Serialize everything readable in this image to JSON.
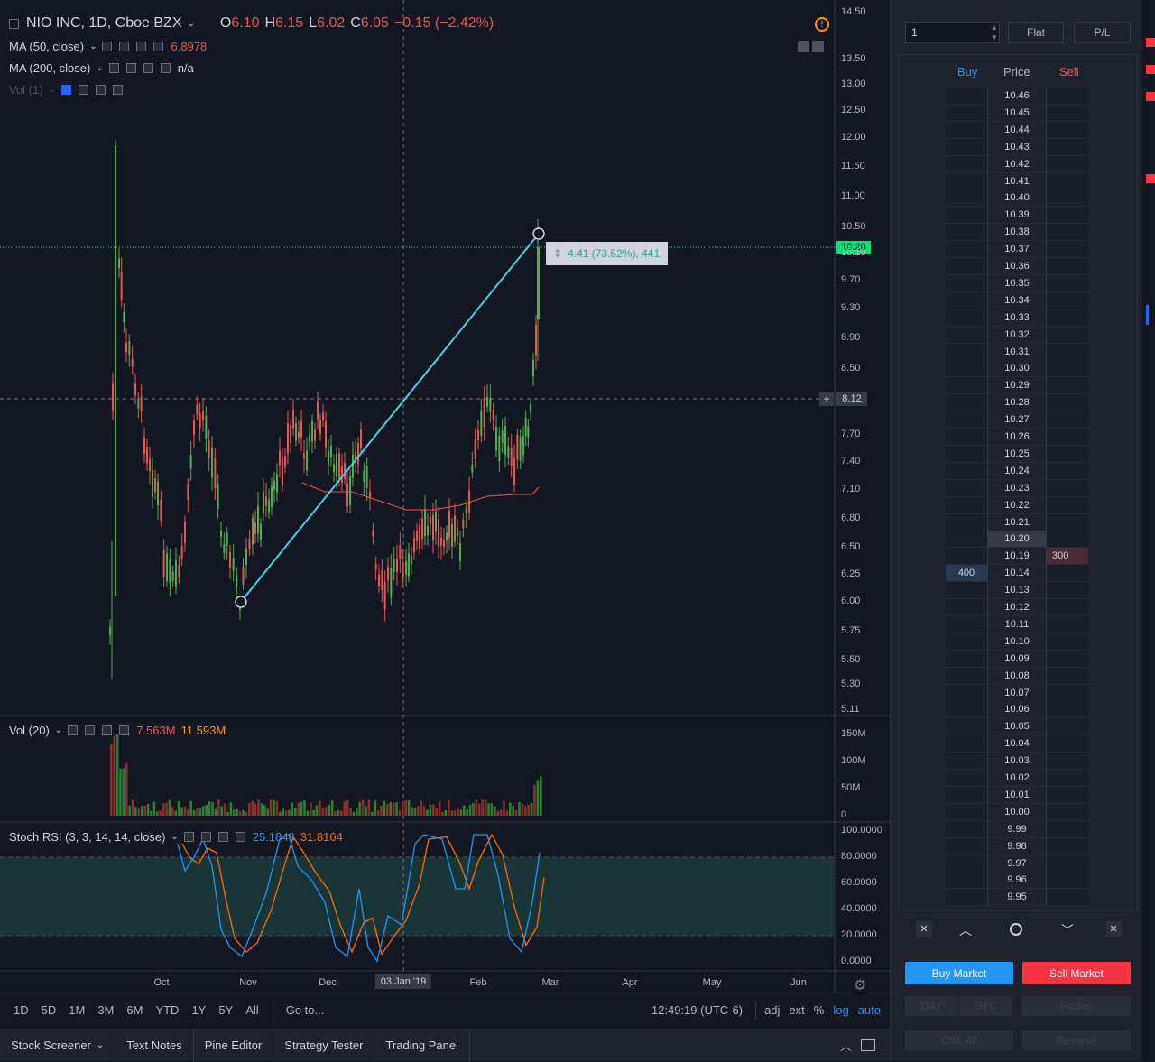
{
  "symbol": {
    "title": "NIO INC, 1D, Cboe BZX",
    "open_label": "O",
    "open": "6.10",
    "high_label": "H",
    "high": "6.15",
    "low_label": "L",
    "low": "6.02",
    "close_label": "C",
    "close": "6.05",
    "change": "−0.15 (−2.42%)"
  },
  "indicators": {
    "ma50": {
      "label": "MA (50, close)",
      "value": "6.8978",
      "color": "#ef5350"
    },
    "ma200": {
      "label": "MA (200, close)",
      "value": "n/a"
    },
    "vol1": {
      "label": "Vol (1)"
    },
    "vol20": {
      "label": "Vol (20)",
      "value1": "7.563M",
      "value2": "11.593M"
    },
    "stoch": {
      "label": "Stoch RSI (3, 3, 14, 14, close)",
      "k": "25.1848",
      "d": "31.8164"
    }
  },
  "measure_tooltip": "4.41 (73.52%), 441",
  "crosshair_price": "8.12",
  "last_price": "10.20",
  "price_axis": [
    "14.50",
    "13.50",
    "13.00",
    "12.50",
    "12.00",
    "11.50",
    "11.00",
    "10.50",
    "10.10",
    "9.70",
    "9.30",
    "8.90",
    "8.50",
    "7.70",
    "7.40",
    "7.10",
    "6.80",
    "6.50",
    "6.25",
    "6.00",
    "5.75",
    "5.50",
    "5.30",
    "5.11"
  ],
  "volume_axis": [
    "150M",
    "100M",
    "50M",
    "0"
  ],
  "stoch_axis": [
    "100.0000",
    "80.0000",
    "60.0000",
    "40.0000",
    "20.0000",
    "0.0000"
  ],
  "time_axis": [
    "Oct",
    "Nov",
    "Dec",
    "03 Jan '19",
    "Feb",
    "Mar",
    "Apr",
    "May",
    "Jun"
  ],
  "bottom_bar": {
    "timeframes": [
      "1D",
      "5D",
      "1M",
      "3M",
      "6M",
      "YTD",
      "1Y",
      "5Y",
      "All"
    ],
    "goto": "Go to...",
    "clock": "12:49:19 (UTC-6)",
    "adj": "adj",
    "ext": "ext",
    "pct": "%",
    "log": "log",
    "auto": "auto"
  },
  "bottom_tabs": [
    "Stock Screener",
    "Text Notes",
    "Pine Editor",
    "Strategy Tester",
    "Trading Panel"
  ],
  "trading": {
    "quantity": "1",
    "flat": "Flat",
    "pl": "P/L",
    "col_buy": "Buy",
    "col_price": "Price",
    "col_sell": "Sell",
    "ladder": [
      "10.46",
      "10.45",
      "10.44",
      "10.43",
      "10.42",
      "10.41",
      "10.40",
      "10.39",
      "10.38",
      "10.37",
      "10.36",
      "10.35",
      "10.34",
      "10.33",
      "10.32",
      "10.31",
      "10.30",
      "10.29",
      "10.28",
      "10.27",
      "10.26",
      "10.25",
      "10.24",
      "10.23",
      "10.22",
      "10.21",
      "10.20",
      "10.19",
      "10.14",
      "10.13",
      "10.12",
      "10.11",
      "10.10",
      "10.09",
      "10.08",
      "10.07",
      "10.06",
      "10.05",
      "10.04",
      "10.03",
      "10.02",
      "10.01",
      "10.00",
      "9.99",
      "9.98",
      "9.97",
      "9.96",
      "9.95"
    ],
    "sell_qty": "300",
    "buy_qty": "400",
    "buy_market": "Buy Market",
    "sell_market": "Sell Market",
    "day": "DAY",
    "gtc": "GTC",
    "flatten": "Flatten",
    "cxl_all": "CXL All",
    "reverse": "Reverse"
  },
  "colors": {
    "up": "#4caf50",
    "down": "#ef5350",
    "trendline": "#4dd0e1",
    "last_price_bg": "#00e676",
    "accent": "#2196f3"
  }
}
